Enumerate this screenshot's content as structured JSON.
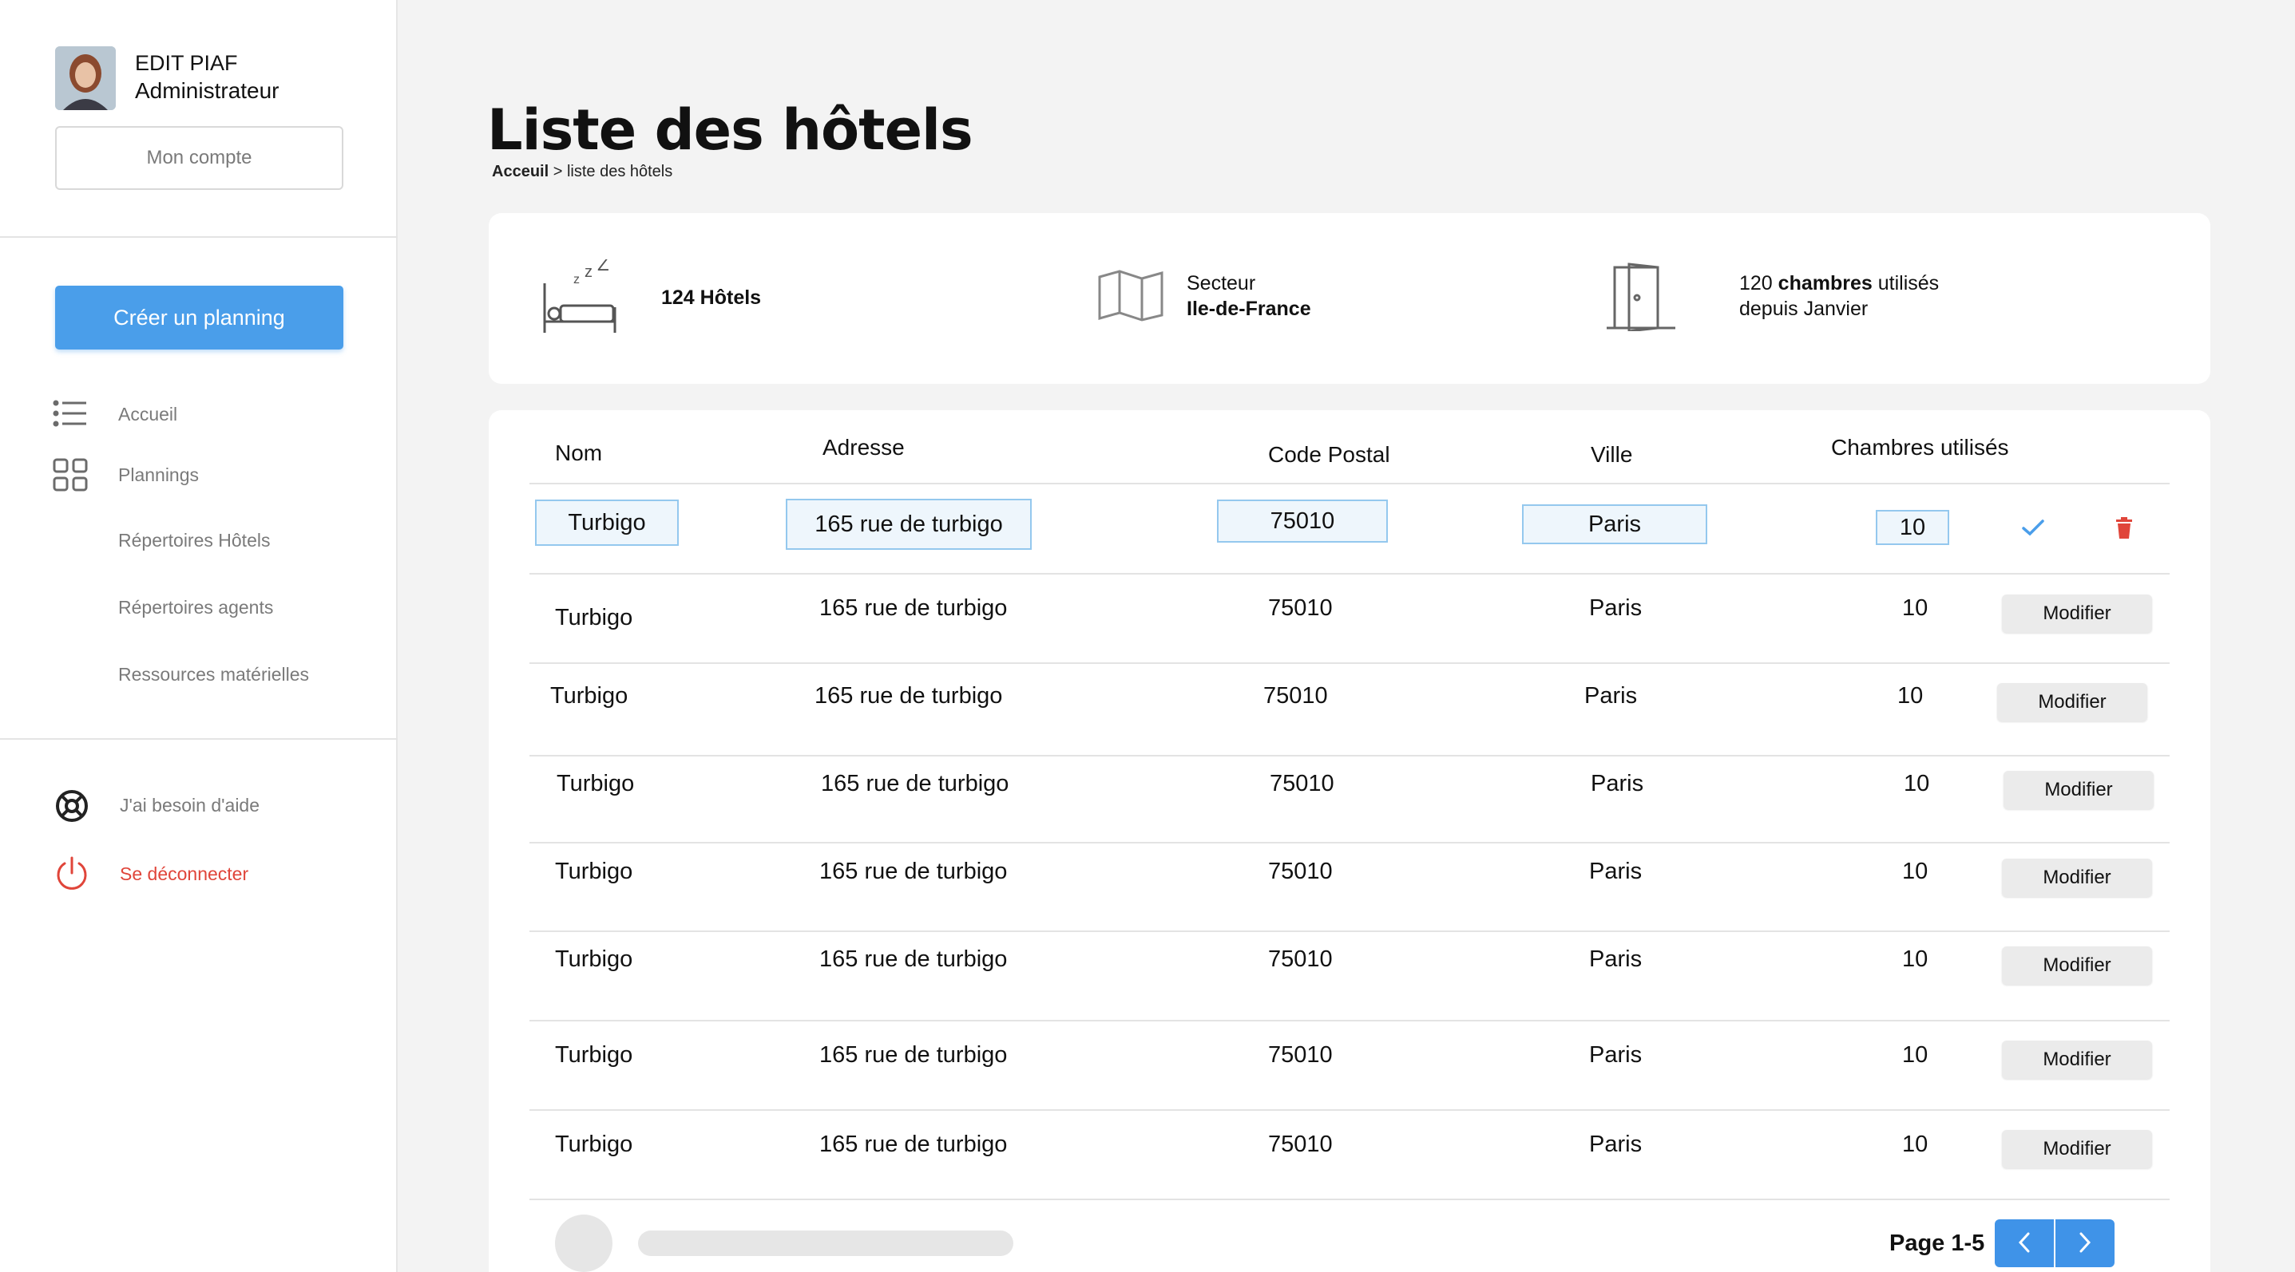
{
  "user": {
    "name": "EDIT PIAF",
    "role": "Administrateur",
    "account_label": "Mon compte"
  },
  "sidebar": {
    "create_label": "Créer un planning",
    "items": [
      {
        "label": "Accueil",
        "icon": "list-icon"
      },
      {
        "label": "Plannings",
        "icon": "grid-icon"
      },
      {
        "label": "Répertoires Hôtels"
      },
      {
        "label": "Répertoires agents"
      },
      {
        "label": "Ressources matérielles"
      }
    ],
    "help_label": "J'ai besoin d'aide",
    "logout_label": "Se déconnecter"
  },
  "page": {
    "title": "Liste des hôtels",
    "breadcrumb_root": "Acceuil",
    "breadcrumb_current": "> liste des hôtels"
  },
  "stats": {
    "hotels_count": "124",
    "hotels_label": "Hôtels",
    "sector_label": "Secteur",
    "sector_value": "Ile-de-France",
    "rooms_count": "120",
    "rooms_label": "chambres",
    "rooms_suffix": "utilisés",
    "rooms_since": "depuis Janvier"
  },
  "table": {
    "headers": [
      "Nom",
      "Adresse",
      "Code Postal",
      "Ville",
      "Chambres utilisés"
    ],
    "edit_row": {
      "nom": "Turbigo",
      "adresse": "165 rue de turbigo",
      "code_postal": "75010",
      "ville": "Paris",
      "chambres": "10"
    },
    "rows": [
      {
        "nom": "Turbigo",
        "adresse": "165 rue de turbigo",
        "code_postal": "75010",
        "ville": "Paris",
        "chambres": "10"
      },
      {
        "nom": "Turbigo",
        "adresse": "165 rue de turbigo",
        "code_postal": "75010",
        "ville": "Paris",
        "chambres": "10"
      },
      {
        "nom": "Turbigo",
        "adresse": "165 rue de turbigo",
        "code_postal": "75010",
        "ville": "Paris",
        "chambres": "10"
      },
      {
        "nom": "Turbigo",
        "adresse": "165 rue de turbigo",
        "code_postal": "75010",
        "ville": "Paris",
        "chambres": "10"
      },
      {
        "nom": "Turbigo",
        "adresse": "165 rue de turbigo",
        "code_postal": "75010",
        "ville": "Paris",
        "chambres": "10"
      },
      {
        "nom": "Turbigo",
        "adresse": "165 rue de turbigo",
        "code_postal": "75010",
        "ville": "Paris",
        "chambres": "10"
      },
      {
        "nom": "Turbigo",
        "adresse": "165 rue de turbigo",
        "code_postal": "75010",
        "ville": "Paris",
        "chambres": "10"
      }
    ],
    "modify_label": "Modifier"
  },
  "pagination": {
    "label": "Page 1-5"
  },
  "colors": {
    "accent": "#4a9eea",
    "danger": "#e0453a",
    "input_border": "#94c8ee"
  }
}
